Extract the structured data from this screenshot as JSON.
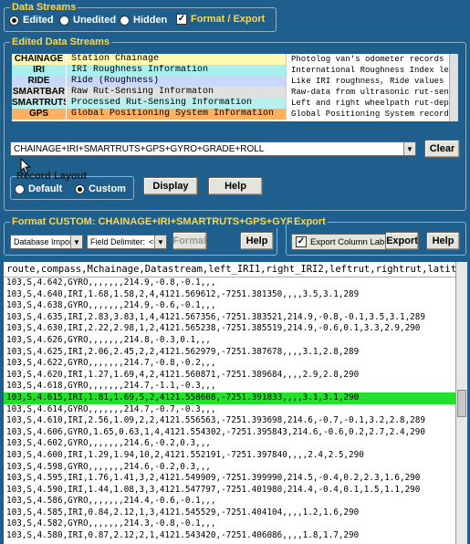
{
  "data_streams": {
    "title": "Data Streams",
    "options": [
      {
        "label": "Edited",
        "selected": true
      },
      {
        "label": "Unedited",
        "selected": false
      },
      {
        "label": "Hidden",
        "selected": false
      }
    ],
    "format_export_label": "Format / Export",
    "format_export_checked": true
  },
  "edited_streams": {
    "title": "Edited Data Streams",
    "rows": [
      {
        "code": "CHAINAGE",
        "name": "Station Chainage",
        "desc": "Photolog van's odometer records",
        "color": "#fff8b0"
      },
      {
        "code": "IRI",
        "name": "IRI Roughness Information",
        "desc": "International Roughness Index le",
        "color": "#a8f0f0"
      },
      {
        "code": "RIDE",
        "name": "Ride (Roughness)",
        "desc": "Like IRI roughness, Ride values",
        "color": "#c8d8f8"
      },
      {
        "code": "SMARTBAR",
        "name": "Raw Rut-Sensing Informaton",
        "desc": "Raw-data from ultrasonic rut-sen",
        "color": "#e0e0e0"
      },
      {
        "code": "SMARTRUTS",
        "name": "Processed Rut-Sensing Information",
        "desc": "Left and right wheelpath rut-dep",
        "color": "#b8f0f0"
      },
      {
        "code": "GPS",
        "name": "Global Positioning System Information",
        "desc": "Global Positioning System record",
        "color": "#ffb060"
      }
    ],
    "selection": "CHAINAGE+IRI+SMARTRUTS+GPS+GYRO+GRADE+ROLL",
    "clear_label": "Clear"
  },
  "record_layout": {
    "title": "Record Layout",
    "options": [
      {
        "label": "Default",
        "selected": false
      },
      {
        "label": "Custom",
        "selected": true
      }
    ],
    "display_label": "Display",
    "help_label": "Help"
  },
  "format_custom": {
    "title": "Format CUSTOM: CHAINAGE+IRI+SMARTRUTS+GPS+GYRO+ . . .",
    "type_value": "Database Import",
    "delimiter_label": "Field Delimiter:",
    "delimiter_value": "<COMMA>",
    "format_label": "Format",
    "help_label": "Help"
  },
  "export": {
    "title": "Export",
    "column_labels_label": "Export Column Labels",
    "column_labels_checked": true,
    "export_label": "Export",
    "help_label": "Help"
  },
  "output": {
    "header": "route,compass,Mchainage,Datastream,left_IRI1,right_IRI2,leftrut,rightrut,latitude,",
    "lines": [
      "103,S,4.642,GYRO,,,,,,,214.9,-0.8,-0.1,,,",
      "103,S,4.640,IRI,1.68,1.58,2,4,4121.569612,-7251.381350,,,,3.5,3.1,289",
      "103,S,4.638,GYRO,,,,,,,214.9,-0.6,-0.1,,,",
      "103,S,4.635,IRI,2.83,3.83,1,4,4121.567356,-7251.383521,214.9,-0.8,-0.1,3.5,3.1,289",
      "103,S,4.630,IRI,2.22,2.98,1,2,4121.565238,-7251.385519,214.9,-0.6,0.1,3.3,2.9,290",
      "103,S,4.626,GYRO,,,,,,,214.8,-0.3,0.1,,,",
      "103,S,4.625,IRI,2.06,2.45,2,2,4121.562979,-7251.387678,,,,3.1,2.8,289",
      "103,S,4.622,GYRO,,,,,,,214.7,-0.8,-0.2,,,",
      "103,S,4.620,IRI,1.27,1.69,4,2,4121.560871,-7251.389684,,,,2.9,2.8,290",
      "103,S,4.618,GYRO,,,,,,,214.7,-1.1,-0.3,,,",
      "103,S,4.615,IRI,1.81,1.69,5,2,4121.558608,-7251.391833,,,,3.1,3.1,290",
      "103,S,4.614,GYRO,,,,,,,214.7,-0.7,-0.3,,,",
      "103,S,4.610,IRI,2.56,1.09,2,2,4121.556563,-7251.393698,214.6,-0.7,-0.1,3.2,2.8,289",
      "103,S,4.606,GYRO,1.65,0.63,1,4,4121.554302,-7251.395843,214.6,-0.6,0.2,2.7,2.4,290",
      "103,S,4.602,GYRO,,,,,,,214.6,-0.2,0.3,,,",
      "103,S,4.600,IRI,1.29,1.94,10,2,4121.552191,-7251.397840,,,,2.4,2.5,290",
      "103,S,4.598,GYRO,,,,,,,214.6,-0.2,0.3,,,",
      "103,S,4.595,IRI,1.76,1.41,3,2,4121.549909,-7251.399990,214.5,-0.4,0.2,2.3,1.6,290",
      "103,S,4.590,IRI,1.44,1.08,3,3,4121.547797,-7251.401980,214.4,-0.4,0.1,1.5,1.1,290",
      "103,S,4.586,GYRO,,,,,,,214.4,-0.6,-0.1,,,",
      "103,S,4.585,IRI,0.84,2.12,1,3,4121.545529,-7251.404104,,,,1.2,1.6,290",
      "103,S,4.582,GYRO,,,,,,,214.3,-0.8,-0.1,,,",
      "103,S,4.580,IRI,0.87,2.12,2,1,4121.543420,-7251.406086,,,,1.8,1.7,290"
    ],
    "highlight_index": 10
  }
}
